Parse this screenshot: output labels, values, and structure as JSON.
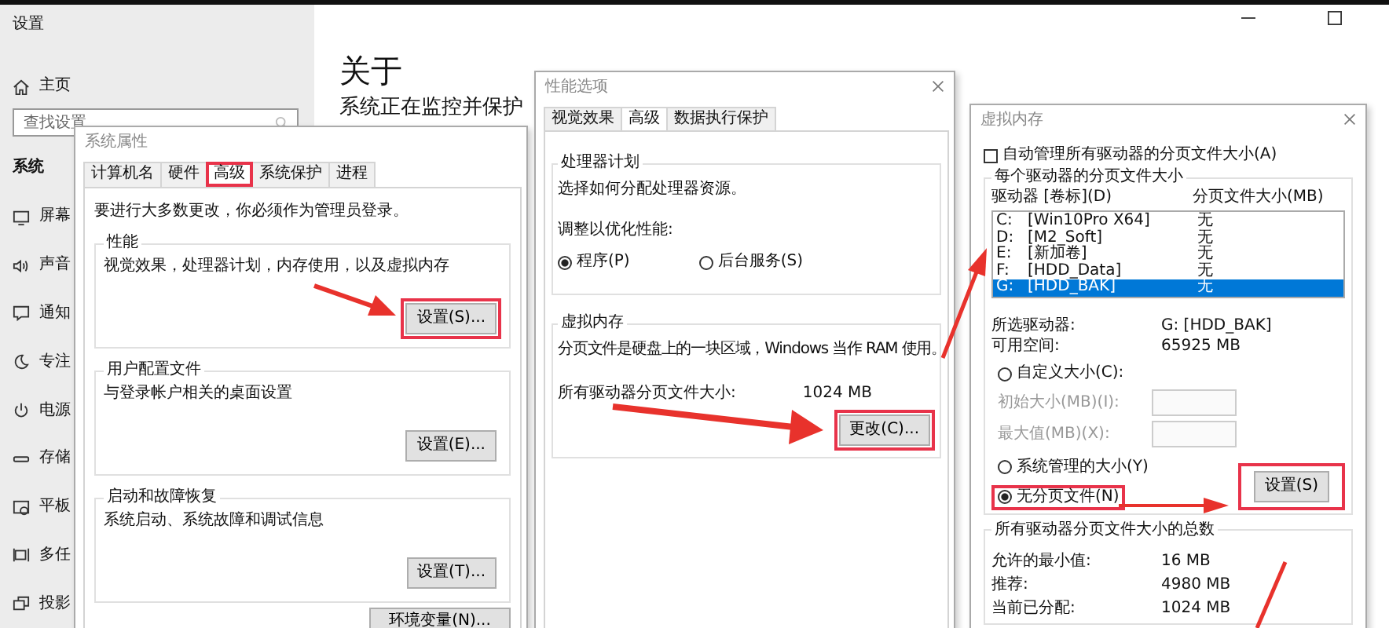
{
  "settings": {
    "title": "设置",
    "home": "主页",
    "search": {
      "placeholder": "查找设置"
    },
    "section": "系统",
    "nav": [
      {
        "label": "屏幕",
        "kind": "display"
      },
      {
        "label": "声音",
        "kind": "sound"
      },
      {
        "label": "通知",
        "kind": "notify"
      },
      {
        "label": "专注",
        "kind": "moon"
      },
      {
        "label": "电源",
        "kind": "power"
      },
      {
        "label": "存储",
        "kind": "storage"
      },
      {
        "label": "平板",
        "kind": "tablet"
      },
      {
        "label": "多任",
        "kind": "multitask"
      },
      {
        "label": "投影",
        "kind": "project"
      }
    ],
    "heading": "关于",
    "subheading": "系统正在监控并保护"
  },
  "system_properties": {
    "title": "系统属性",
    "tabs": [
      {
        "label": "计算机名",
        "selected": false,
        "highlighted": false
      },
      {
        "label": "硬件",
        "selected": false,
        "highlighted": false
      },
      {
        "label": "高级",
        "selected": true,
        "highlighted": true
      },
      {
        "label": "系统保护",
        "selected": false,
        "highlighted": false
      },
      {
        "label": "进程",
        "selected": false,
        "highlighted": false
      }
    ],
    "notice": "要进行大多数更改，你必须作为管理员登录。",
    "groups": [
      {
        "title": "性能",
        "text": "视觉效果，处理器计划，内存使用，以及虚拟内存",
        "button": {
          "label": "设置(S)...",
          "highlighted": true
        }
      },
      {
        "title": "用户配置文件",
        "text": "与登录帐户相关的桌面设置",
        "button": {
          "label": "设置(E)...",
          "highlighted": false
        }
      },
      {
        "title": "启动和故障恢复",
        "text": "系统启动、系统故障和调试信息",
        "button": {
          "label": "设置(T)...",
          "highlighted": false
        }
      }
    ],
    "footer_button": "环境变量(N)..."
  },
  "performance_options": {
    "title": "性能选项",
    "tabs": [
      {
        "label": "视觉效果",
        "selected": false
      },
      {
        "label": "高级",
        "selected": true
      },
      {
        "label": "数据执行保护",
        "selected": false
      }
    ],
    "processor": {
      "title": "处理器计划",
      "text": "选择如何分配处理器资源。",
      "prompt": "调整以优化性能:",
      "options": [
        {
          "label": "程序(P)",
          "selected": true
        },
        {
          "label": "后台服务(S)",
          "selected": false
        }
      ]
    },
    "virtual_memory": {
      "title": "虚拟内存",
      "text": "分页文件是硬盘上的一块区域，Windows 当作 RAM 使用。",
      "total_label": "所有驱动器分页文件大小:",
      "total_value": "1024 MB",
      "button": {
        "label": "更改(C)...",
        "highlighted": true
      }
    }
  },
  "virtual_memory": {
    "title": "虚拟内存",
    "auto_manage": {
      "label": "自动管理所有驱动器的分页文件大小(A)",
      "checked": false
    },
    "group_title": "每个驱动器的分页文件大小",
    "columns": [
      "驱动器 [卷标](D)",
      "分页文件大小(MB)"
    ],
    "drives": [
      {
        "drive": "C:",
        "label": "[Win10Pro X64]",
        "size": "无",
        "selected": false
      },
      {
        "drive": "D:",
        "label": "[M2_Soft]",
        "size": "无",
        "selected": false
      },
      {
        "drive": "E:",
        "label": "[新加卷]",
        "size": "无",
        "selected": false
      },
      {
        "drive": "F:",
        "label": "[HDD_Data]",
        "size": "无",
        "selected": false
      },
      {
        "drive": "G:",
        "label": "[HDD_BAK]",
        "size": "无",
        "selected": true
      }
    ],
    "selected_drive_label": "所选驱动器:",
    "selected_drive": "G:  [HDD_BAK]",
    "free_space_label": "可用空间:",
    "free_space": "65925 MB",
    "size_options": [
      {
        "label": "自定义大小(C):",
        "selected": false,
        "highlighted": false
      },
      {
        "label": "系统管理的大小(Y)",
        "selected": false,
        "highlighted": false
      },
      {
        "label": "无分页文件(N)",
        "selected": true,
        "highlighted": true
      }
    ],
    "custom_fields": [
      {
        "label": "初始大小(MB)(I):",
        "disabled": true
      },
      {
        "label": "最大值(MB)(X):",
        "disabled": true
      }
    ],
    "set_button": {
      "label": "设置(S)",
      "highlighted": true
    },
    "totals_title": "所有驱动器分页文件大小的总数",
    "totals": [
      {
        "label": "允许的最小值:",
        "value": "16 MB"
      },
      {
        "label": "推荐:",
        "value": "4980 MB"
      },
      {
        "label": "当前已分配:",
        "value": "1024 MB"
      }
    ]
  }
}
